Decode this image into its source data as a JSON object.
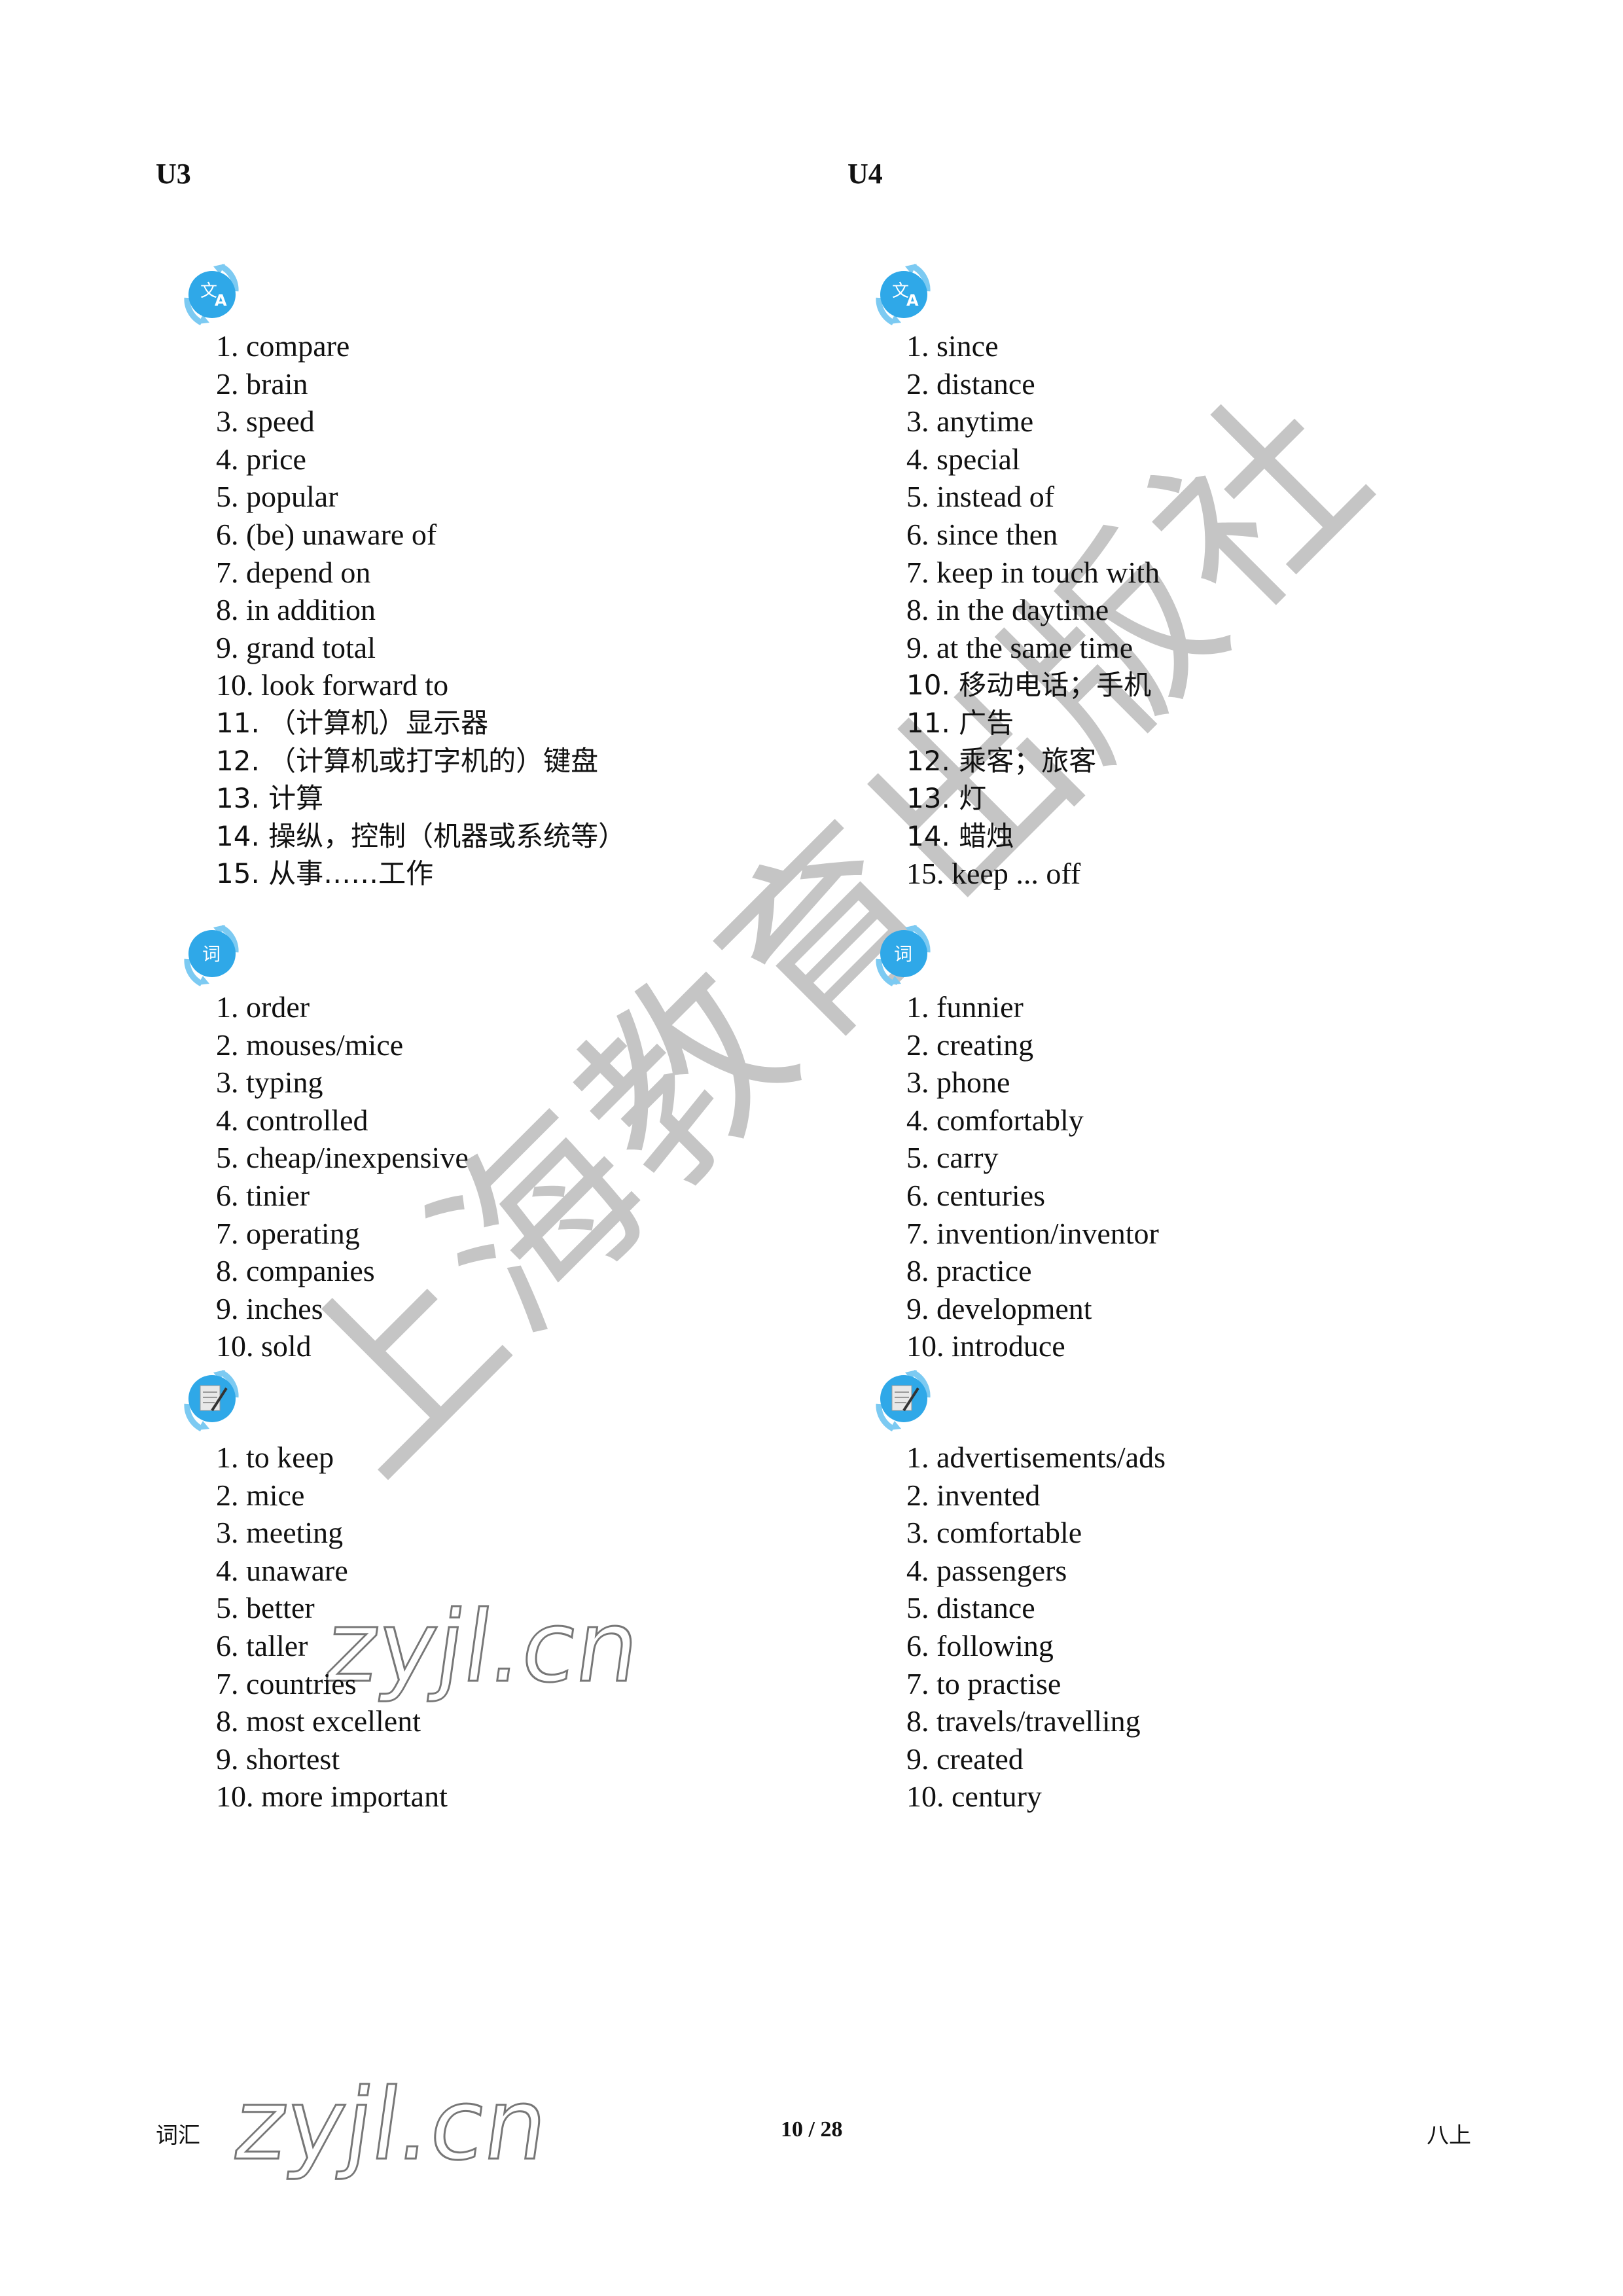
{
  "units": [
    {
      "title": "U3",
      "sections": [
        {
          "icon": "translate-icon",
          "items": [
            "1. compare",
            "2. brain",
            "3. speed",
            "4. price",
            "5. popular",
            "6. (be) unaware of",
            "7. depend on",
            "8. in addition",
            "9. grand total",
            "10. look forward to",
            "11. （计算机）显示器",
            "12. （计算机或打字机的）键盘",
            "13. 计算",
            "14. 操纵，控制（机器或系统等）",
            "15. 从事……工作"
          ]
        },
        {
          "icon": "word-icon",
          "icon_label": "词",
          "items": [
            "1. order",
            "2. mouses/mice",
            "3. typing",
            "4. controlled",
            "5. cheap/inexpensive",
            "6. tinier",
            "7. operating",
            "8. companies",
            "9. inches",
            "10. sold"
          ]
        },
        {
          "icon": "notepad-pen-icon",
          "items": [
            "1. to keep",
            "2. mice",
            "3. meeting",
            "4. unaware",
            "5. better",
            "6. taller",
            "7. countries",
            "8. most excellent",
            "9. shortest",
            "10. more important"
          ]
        }
      ]
    },
    {
      "title": "U4",
      "sections": [
        {
          "icon": "translate-icon",
          "items": [
            "1. since",
            "2. distance",
            "3. anytime",
            "4. special",
            "5. instead of",
            "6. since then",
            "7. keep in touch with",
            "8. in the daytime",
            "9. at the same time",
            "10. 移动电话；手机",
            "11. 广告",
            "12. 乘客；旅客",
            "13. 灯",
            "14. 蜡烛",
            "15. keep ... off"
          ]
        },
        {
          "icon": "word-icon",
          "icon_label": "词",
          "items": [
            "1. funnier",
            "2. creating",
            "3. phone",
            "4. comfortably",
            "5. carry",
            "6. centuries",
            "7. invention/inventor",
            "8. practice",
            "9. development",
            "10. introduce"
          ]
        },
        {
          "icon": "notepad-pen-icon",
          "items": [
            "1. advertisements/ads",
            "2. invented",
            "3. comfortable",
            "4. passengers",
            "5. distance",
            "6. following",
            "7. to practise",
            "8. travels/travelling",
            "9. created",
            "10. century"
          ]
        }
      ]
    }
  ],
  "footer": {
    "left": "词汇",
    "page": "10 / 28",
    "right": "八上"
  },
  "watermarks": {
    "publisher": "上海教育出版社",
    "site": "zyjl.cn"
  },
  "colors": {
    "badge": "#2fa8e8",
    "badge_arrow": "#7ccaf2",
    "text": "#111111",
    "watermark": "#9a9a9a"
  }
}
